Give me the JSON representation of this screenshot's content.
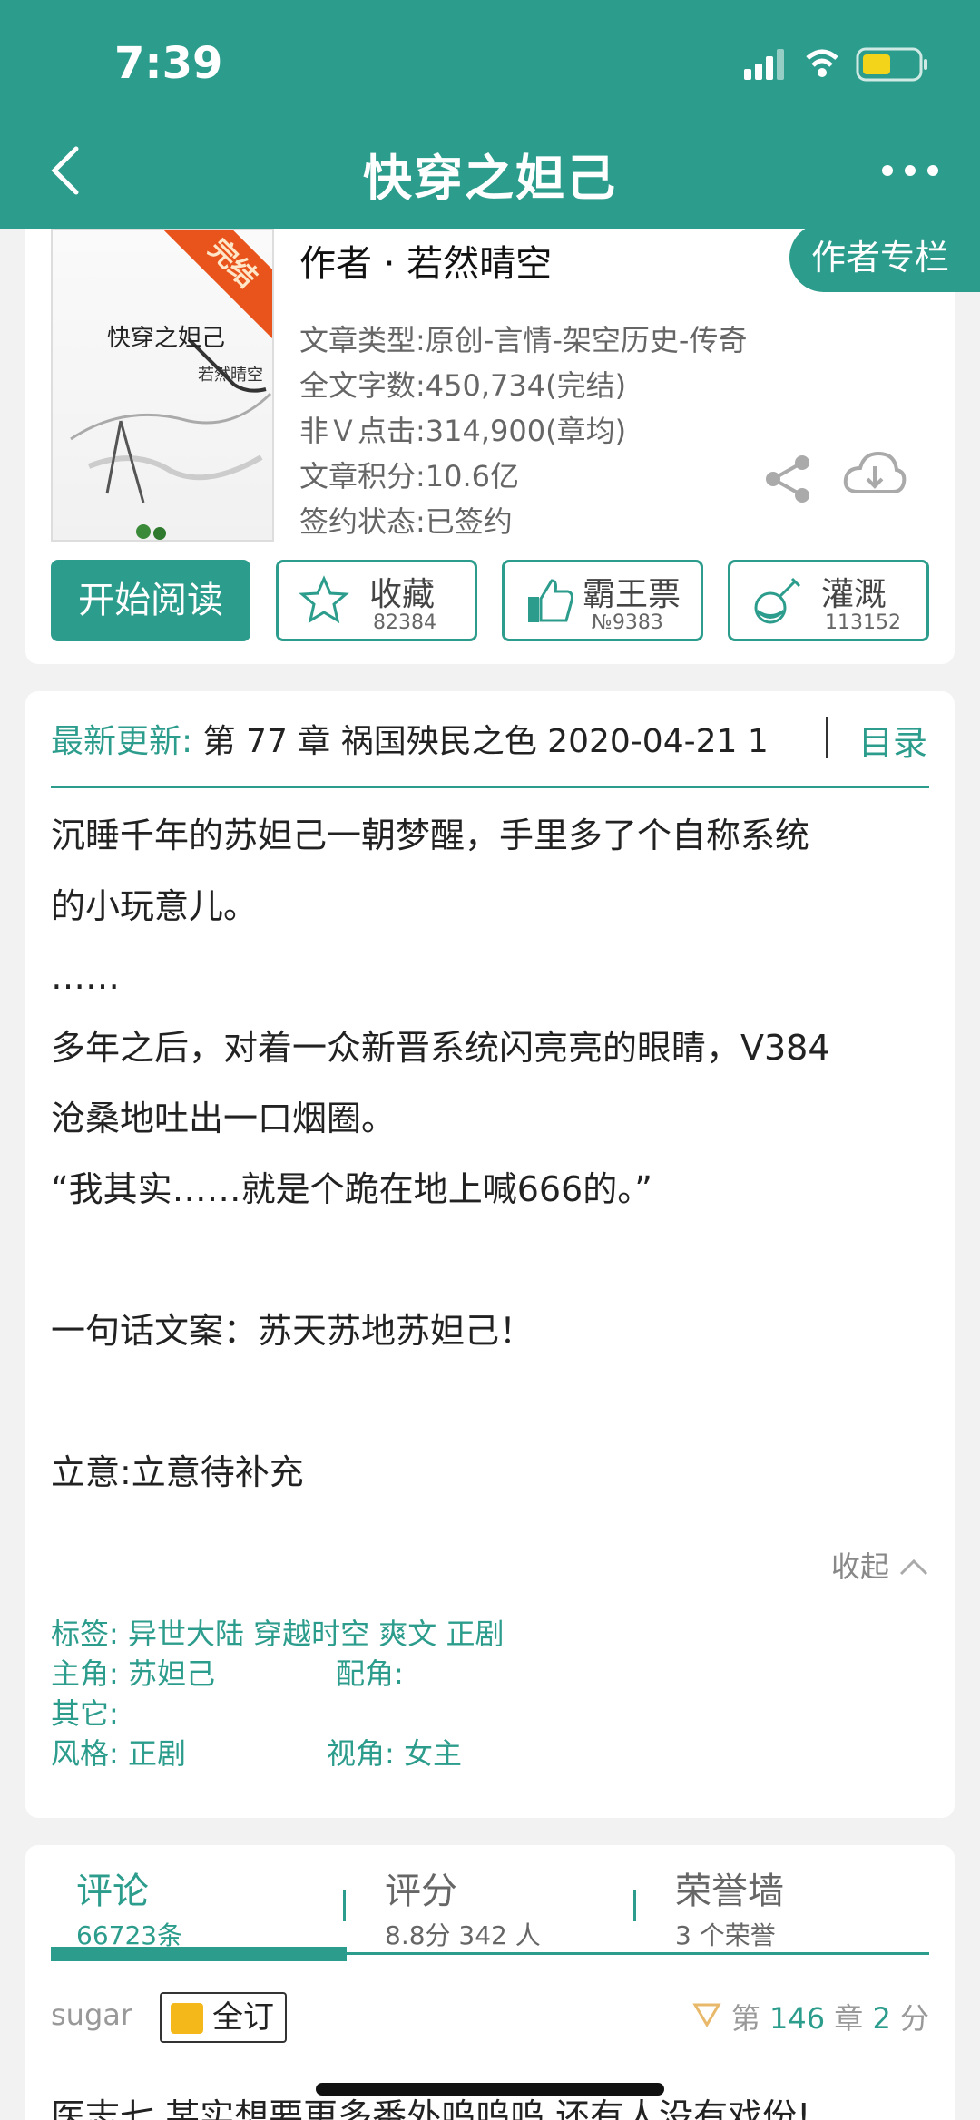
{
  "status_bar": {
    "time": "7:39"
  },
  "nav": {
    "title": "快穿之妲己"
  },
  "book": {
    "cover_title": "快穿之妲己",
    "cover_author": "若然晴空",
    "ribbon": "完结",
    "author": "作者 · 若然晴空",
    "author_column_label": "作者专栏",
    "meta": [
      "文章类型:原创-言情-架空历史-传奇",
      "全文字数:450,734(完结)",
      "非Ｖ点击:314,900(章均)",
      "文章积分:10.6亿",
      "签约状态:已签约"
    ]
  },
  "actions": {
    "read_label": "开始阅读",
    "favorite": {
      "label": "收藏",
      "count": "82384"
    },
    "ticket": {
      "label": "霸王票",
      "count": "№9383"
    },
    "irrigate": {
      "label": "灌溉",
      "count": "113152"
    }
  },
  "update": {
    "label": "最新更新:",
    "value": "第 77 章 祸国殃民之色 2020-04-21 1",
    "toc": "目录"
  },
  "synopsis": [
    "沉睡千年的苏妲己一朝梦醒，手里多了个自称系统",
    "的小玩意儿。",
    "……",
    "多年之后，对着一众新晋系统闪亮亮的眼睛，V384",
    "沧桑地吐出一口烟圈。",
    "“我其实……就是个跪在地上喊666的。”",
    "",
    "一句话文案：苏天苏地苏妲己！",
    "",
    "立意:立意待补充"
  ],
  "collapse_label": "收起",
  "tags": {
    "tags_line": "标签:  异世大陆  穿越时空  爽文   正剧",
    "lead_line": "主角:  苏妲己",
    "support_line": "配角:",
    "other_line": "其它:",
    "style_line": "风格:  正剧",
    "view_line": "视角: 女主"
  },
  "tabs": [
    {
      "label": "评论",
      "sub": "66723条"
    },
    {
      "label": "评分",
      "sub": "8.8分 342 人"
    },
    {
      "label": "荣誉墙",
      "sub": "3 个荣誉"
    }
  ],
  "comment": {
    "user": "sugar",
    "badge": "全订",
    "chapter_prefix": "第",
    "chapter_num": "146",
    "chapter_mid": "章",
    "score_num": "2",
    "score_suffix": "分",
    "text": "医志七 某实想要更多番外呜呜呜 还有人没有戏份!"
  },
  "colors": {
    "accent": "#2c9c8c",
    "ribbon": "#e8541b",
    "badge": "#f4b81b"
  }
}
